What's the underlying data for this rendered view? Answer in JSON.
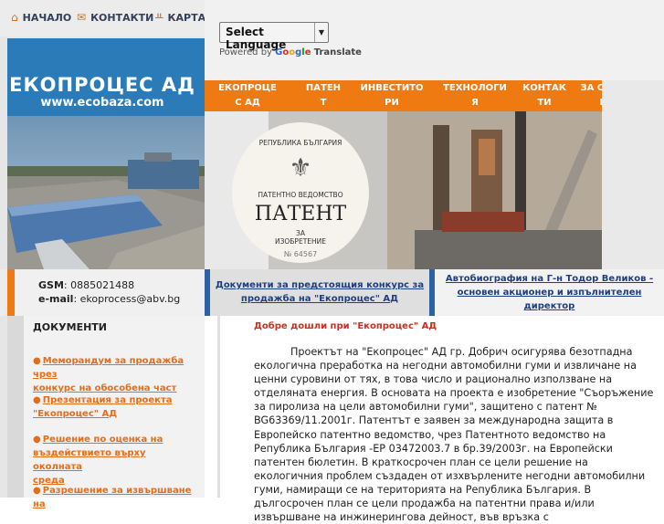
{
  "top_nav": {
    "items": [
      {
        "label": "НАЧАЛО",
        "icon": "home-icon"
      },
      {
        "label": "КОНТАКТИ",
        "icon": "mail-icon"
      },
      {
        "label": "КАРТА",
        "icon": "sitemap-icon"
      }
    ]
  },
  "logo": {
    "title": "ЕКОПРОЦЕС АД",
    "url": "www.ecobaza.com"
  },
  "translate": {
    "select_label": "Select Language",
    "powered_by": "Powered by",
    "google": [
      "G",
      "o",
      "o",
      "g",
      "l",
      "e"
    ],
    "translate_label": "Translate"
  },
  "menu": {
    "items": [
      "ЕКОПРОЦЕС АД",
      "ПАТЕНТ",
      "ИНВЕСТИТОРИ",
      "ТЕХНОЛОГИЯ",
      "КОНТАКТИ",
      "ЗА СВАЛЯНЕ"
    ]
  },
  "patent_image": {
    "republic": "РЕПУБЛИКА БЪЛГАРИЯ",
    "office": "ПАТЕНТНО ВЕДОМСТВО",
    "title": "ПАТЕНТ",
    "for1": "ЗА",
    "for2": "ИЗОБРЕТЕНИЕ",
    "number": "№ 64567"
  },
  "contact": {
    "gsm_label": "GSM",
    "gsm": ": 0885021488",
    "email_label": "e-mail",
    "email": ": ekoprocess@abv.bg"
  },
  "links": {
    "docs_line1": "Документи за предстоящия конкурс за",
    "docs_line2": "продажба на \"Екопроцес\" АД",
    "bio_line1": "Автобиография на Г-н Тодор Великов -",
    "bio_line2": "основен акционер и изпълнителен",
    "bio_line3": "директор"
  },
  "sidebar": {
    "title": "ДОКУМЕНТИ",
    "items": [
      {
        "line1": "Меморандум за продажба чрез",
        "line2": "конкурс на обособена част"
      },
      {
        "line1": "Презентация за проекта",
        "line2": "\"Екопроцес\" АД"
      },
      {
        "line1": "Решение по оценка на",
        "line2": "въздействието върху околната",
        "line3": "среда"
      },
      {
        "line1": "Разрешение за извършване на",
        "line2": ""
      }
    ]
  },
  "main": {
    "heading": "Добре дошли при \"Екопроцес\" АД",
    "paragraph": "Проектът на \"Екопроцес\" АД гр. Добрич осигурява безотпадна екологична преработка на негодни автомобилни гуми и извличане на ценни суровини от тях,    в това число и рационално използване на отделяната енергия. В основата на проекта е изобретение \"Съоръжение за пиролиза на цели автомобилни гуми\", защитено с патент  №  BG63369/11.2001г. Патентът е заявен за международна защита в Европейско патентно ведомство, чрез Патентното ведомство на Република България  -ЕР 03472003.7 в бр.39/2003г. на Европейски патентен бюлетин.           В краткосрочен план се цели решение на екологичния проблем създаден от изхвърлените негодни автомобилни гуми, намиращи се на територията на Република България.  В дългосрочен план се цели продажба на патентни права и/или извършване на инжинеринговa дейност, във връзка с"
  },
  "colors": {
    "orange": "#f07a12",
    "blue": "#2b7bb9",
    "link_blue": "#1f3f7f",
    "heading_red": "#c9301f"
  }
}
